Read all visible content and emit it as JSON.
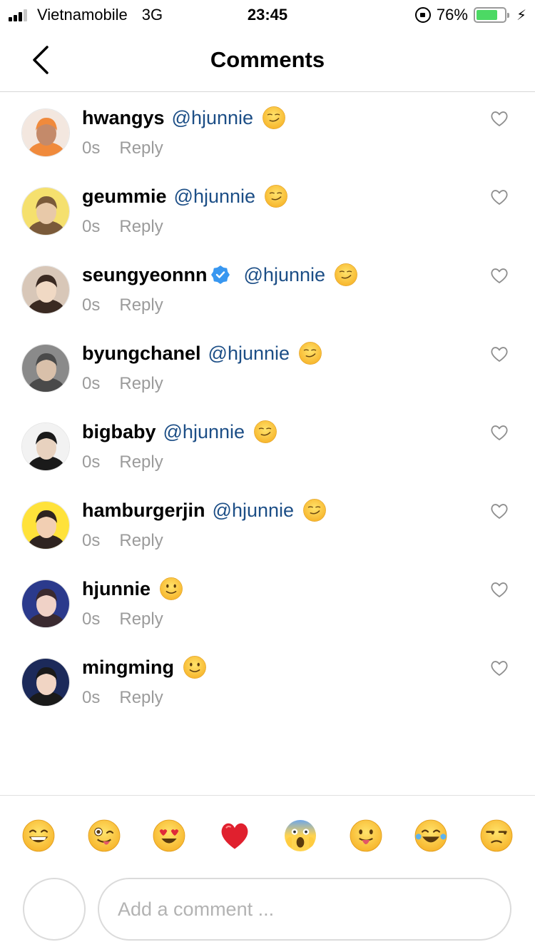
{
  "status_bar": {
    "carrier": "Vietnamobile",
    "network": "3G",
    "time": "23:45",
    "battery_percent": "76%",
    "battery_level": 0.76,
    "battery_color": "#4cd964"
  },
  "header": {
    "title": "Comments",
    "back_icon": "chevron-left-icon"
  },
  "colors": {
    "mention": "#1c4e86",
    "meta": "#9b9b9b",
    "verified": "#3897f0"
  },
  "comments": [
    {
      "username": "hwangys",
      "verified": false,
      "mention": "@hjunnie",
      "emoji": "smirking-face",
      "time": "0s",
      "reply": "Reply"
    },
    {
      "username": "geummie",
      "verified": false,
      "mention": "@hjunnie",
      "emoji": "smirking-face",
      "time": "0s",
      "reply": "Reply"
    },
    {
      "username": "seungyeonnn",
      "verified": true,
      "mention": "@hjunnie",
      "emoji": "smirking-face",
      "time": "0s",
      "reply": "Reply"
    },
    {
      "username": "byungchanel",
      "verified": false,
      "mention": "@hjunnie",
      "emoji": "smirking-face",
      "time": "0s",
      "reply": "Reply"
    },
    {
      "username": "bigbaby",
      "verified": false,
      "mention": "@hjunnie",
      "emoji": "smirking-face",
      "time": "0s",
      "reply": "Reply"
    },
    {
      "username": "hamburgerjin",
      "verified": false,
      "mention": "@hjunnie",
      "emoji": "smirking-face",
      "time": "0s",
      "reply": "Reply"
    },
    {
      "username": "hjunnie",
      "verified": false,
      "mention": "",
      "emoji": "slightly-smiling-face",
      "time": "0s",
      "reply": "Reply"
    },
    {
      "username": "mingming",
      "verified": false,
      "mention": "",
      "emoji": "slightly-smiling-face",
      "time": "0s",
      "reply": "Reply"
    }
  ],
  "quick_emojis": [
    "grinning-face",
    "winking-face-with-tongue",
    "heart-eyes-face",
    "red-heart",
    "screaming-face",
    "face-with-tongue",
    "tears-of-joy-face",
    "unamused-face"
  ],
  "composer": {
    "placeholder": "Add a comment ..."
  }
}
